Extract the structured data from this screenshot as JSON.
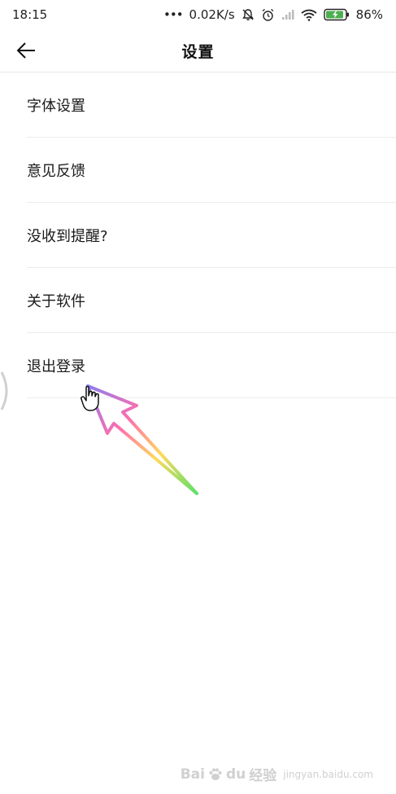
{
  "status_bar": {
    "time": "18:15",
    "dots": "•••",
    "net_speed": "0.02K/s",
    "battery_percent": "86%",
    "icons": [
      "mute-bell-icon",
      "alarm-icon",
      "signal-icon",
      "wifi-icon",
      "battery-charging-icon"
    ]
  },
  "header": {
    "title": "设置",
    "back_icon": "arrow-left-icon"
  },
  "menu": {
    "items": [
      {
        "label": "字体设置"
      },
      {
        "label": "意见反馈"
      },
      {
        "label": "没收到提醒?"
      },
      {
        "label": "关于软件"
      },
      {
        "label": "退出登录"
      }
    ]
  },
  "watermark": {
    "brand": "Bai",
    "paw": "du",
    "suffix": "经验",
    "sub": "jingyan.baidu.com"
  },
  "colors": {
    "background": "#ffffff",
    "divider": "#ececec",
    "text": "#1a1a1a",
    "battery": "#4caf50"
  }
}
